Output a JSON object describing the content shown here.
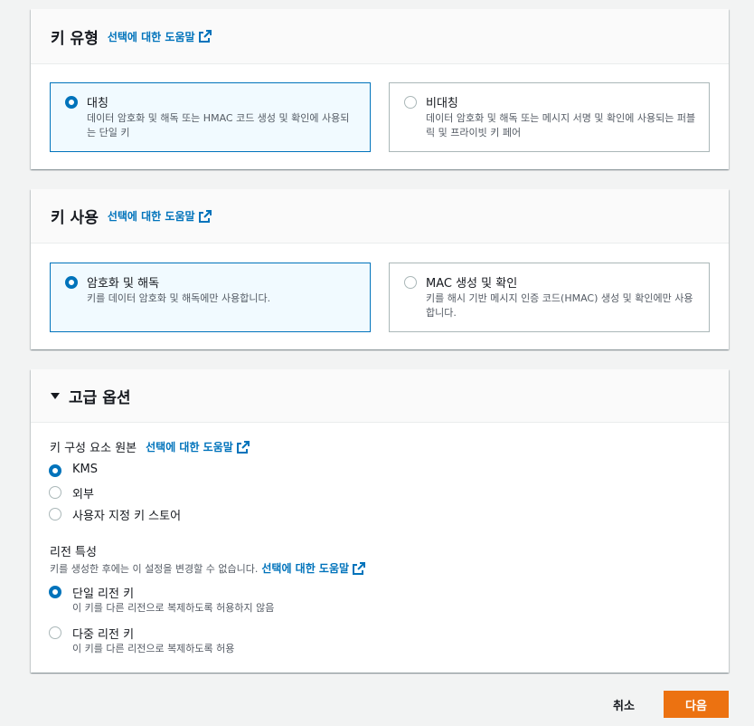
{
  "key_type": {
    "title": "키 유형",
    "info_link": "선택에 대한 도움말",
    "options": [
      {
        "label": "대칭",
        "description": "데이터 암호화 및 해독 또는 HMAC 코드 생성 및 확인에 사용되는 단일 키",
        "selected": true
      },
      {
        "label": "비대칭",
        "description": "데이터 암호화 및 해독 또는 메시지 서명 및 확인에 사용되는 퍼블릭 및 프라이빗 키 페어",
        "selected": false
      }
    ]
  },
  "key_usage": {
    "title": "키 사용",
    "info_link": "선택에 대한 도움말",
    "options": [
      {
        "label": "암호화 및 해독",
        "description": "키를 데이터 암호화 및 해독에만 사용합니다.",
        "selected": true
      },
      {
        "label": "MAC 생성 및 확인",
        "description": "키를 해시 기반 메시지 인증 코드(HMAC) 생성 및 확인에만 사용합니다.",
        "selected": false
      }
    ]
  },
  "advanced": {
    "title": "고급 옵션",
    "key_material_origin": {
      "label": "키 구성 요소 원본",
      "info_link": "선택에 대한 도움말",
      "options": [
        {
          "label": "KMS",
          "selected": true
        },
        {
          "label": "외부",
          "selected": false
        },
        {
          "label": "사용자 지정 키 스토어",
          "selected": false
        }
      ]
    },
    "regionality": {
      "label": "리전 특성",
      "description": "키를 생성한 후에는 이 설정을 변경할 수 없습니다.",
      "info_link": "선택에 대한 도움말",
      "options": [
        {
          "label": "단일 리전 키",
          "description": "이 키를 다른 리전으로 복제하도록 허용하지 않음",
          "selected": true
        },
        {
          "label": "다중 리전 키",
          "description": "이 키를 다른 리전으로 복제하도록 허용",
          "selected": false
        }
      ]
    }
  },
  "footer": {
    "cancel_label": "취소",
    "next_label": "다음"
  },
  "colors": {
    "accent": "#0073bb",
    "primary_button": "#ec7211"
  },
  "icons": {
    "external_link": "external-link-icon",
    "expand": "caret-down-icon"
  }
}
